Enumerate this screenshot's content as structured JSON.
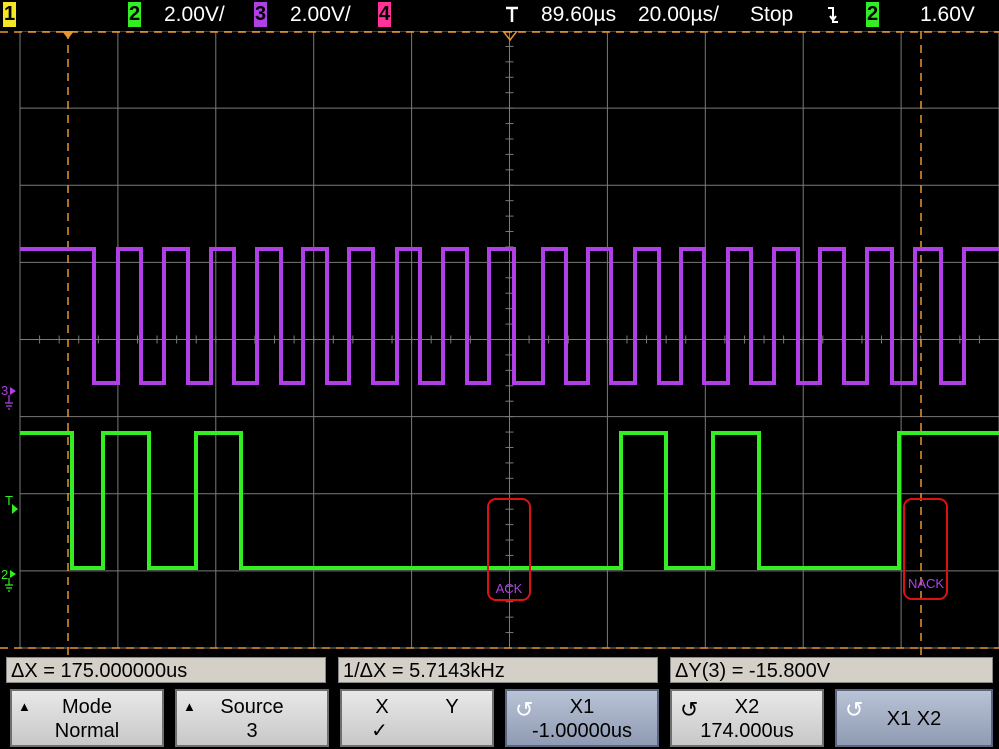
{
  "topbar": {
    "ch1_label": "1",
    "ch2_label": "2",
    "ch2_scale": "2.00V/",
    "ch3_label": "3",
    "ch3_scale": "2.00V/",
    "ch4_label": "4",
    "trigger_icon": "trigger-marker-icon",
    "time_delay": "89.60µs",
    "time_scale": "20.00µs/",
    "run_state": "Stop",
    "edge_icon": "falling-edge-icon",
    "trigger_source": "2",
    "trigger_level": "1.60V"
  },
  "colors": {
    "ch1": "#f5e623",
    "ch2": "#33ee22",
    "ch3": "#b040e6",
    "ch4": "#ff3399",
    "grid": "#7a7a7a",
    "cursor": "#e8962e",
    "annotation": "#dd1111",
    "softkey_dark": "#9aa6bf"
  },
  "markers": {
    "ch3": "3",
    "trigger": "T",
    "ch2": "2"
  },
  "annotations": [
    {
      "label": "ACK"
    },
    {
      "label": "NACK"
    }
  ],
  "measurements": {
    "dx": "ΔX = 175.000000us",
    "inv_dx": "1/ΔX = 5.7143kHz",
    "dy": "ΔY(3) = -15.800V"
  },
  "softkeys": [
    {
      "line1": "Mode",
      "line2": "Normal"
    },
    {
      "line1": "Source",
      "line2": "3"
    },
    {
      "line1": "X",
      "line1b": "Y",
      "line2": "✓"
    },
    {
      "line1": "X1",
      "line2": "-1.00000us"
    },
    {
      "line1": "X2",
      "line2": "174.000us"
    },
    {
      "line1": "X1 X2",
      "line2": ""
    }
  ]
}
